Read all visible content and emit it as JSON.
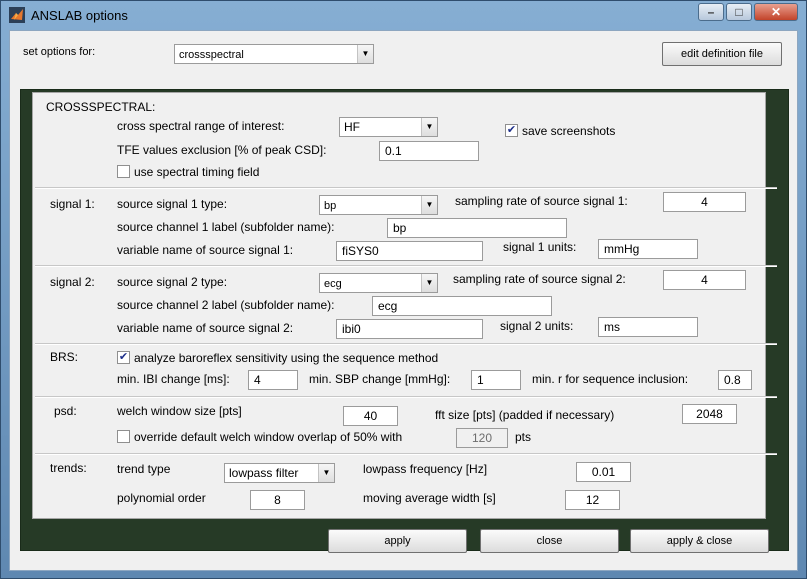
{
  "window": {
    "title": "ANSLAB options"
  },
  "titlebar": {
    "minimize": "–",
    "maximize": "□",
    "close": "✕"
  },
  "header": {
    "set_options_label": "set options for:",
    "set_options_value": "crossspectral",
    "edit_definition_label": "edit definition file"
  },
  "crossspectral": {
    "section_label": "CROSSSPECTRAL:",
    "range_label": "cross spectral range of interest:",
    "range_value": "HF",
    "save_screenshots_label": "save screenshots",
    "tfe_label": "TFE values exclusion [% of peak CSD]:",
    "tfe_value": "0.1",
    "spectral_timing_label": "use spectral timing field"
  },
  "signal1": {
    "section_label": "signal 1:",
    "type_label": "source signal 1 type:",
    "type_value": "bp",
    "sampling_label": "sampling rate of source signal 1:",
    "sampling_value": "4",
    "channel_label": "source channel 1 label (subfolder name):",
    "channel_value": "bp",
    "variable_label": "variable name of source signal 1:",
    "variable_value": "fiSYS0",
    "units_label": "signal 1 units:",
    "units_value": "mmHg"
  },
  "signal2": {
    "section_label": "signal 2:",
    "type_label": "source signal 2 type:",
    "type_value": "ecg",
    "sampling_label": "sampling rate of source signal 2:",
    "sampling_value": "4",
    "channel_label": "source channel 2 label (subfolder name):",
    "channel_value": "ecg",
    "variable_label": "variable name of source signal 2:",
    "variable_value": "ibi0",
    "units_label": "signal 2 units:",
    "units_value": "ms"
  },
  "brs": {
    "section_label": "BRS:",
    "analyze_label": "analyze baroreflex sensitivity using the sequence method",
    "ibi_label": "min. IBI change [ms]:",
    "ibi_value": "4",
    "sbp_label": "min. SBP change [mmHg]:",
    "sbp_value": "1",
    "r_label": "min. r for sequence inclusion:",
    "r_value": "0.8"
  },
  "psd": {
    "section_label": "psd:",
    "welch_label": "welch window size [pts]",
    "welch_value": "40",
    "fft_label": "fft size [pts] (padded if necessary)",
    "fft_value": "2048",
    "override_label": "override default welch window overlap of 50% with",
    "overlap_value": "120",
    "pts_label": "pts"
  },
  "trends": {
    "section_label": "trends:",
    "type_label": "trend type",
    "type_value": "lowpass filter",
    "lowpass_label": "lowpass frequency [Hz]",
    "lowpass_value": "0.01",
    "poly_label": "polynomial order",
    "poly_value": "8",
    "moving_label": "moving average width [s]",
    "moving_value": "12"
  },
  "footer": {
    "apply_label": "apply",
    "close_label": "close",
    "apply_close_label": "apply & close"
  },
  "checks": {
    "checked_glyph": "✔"
  }
}
